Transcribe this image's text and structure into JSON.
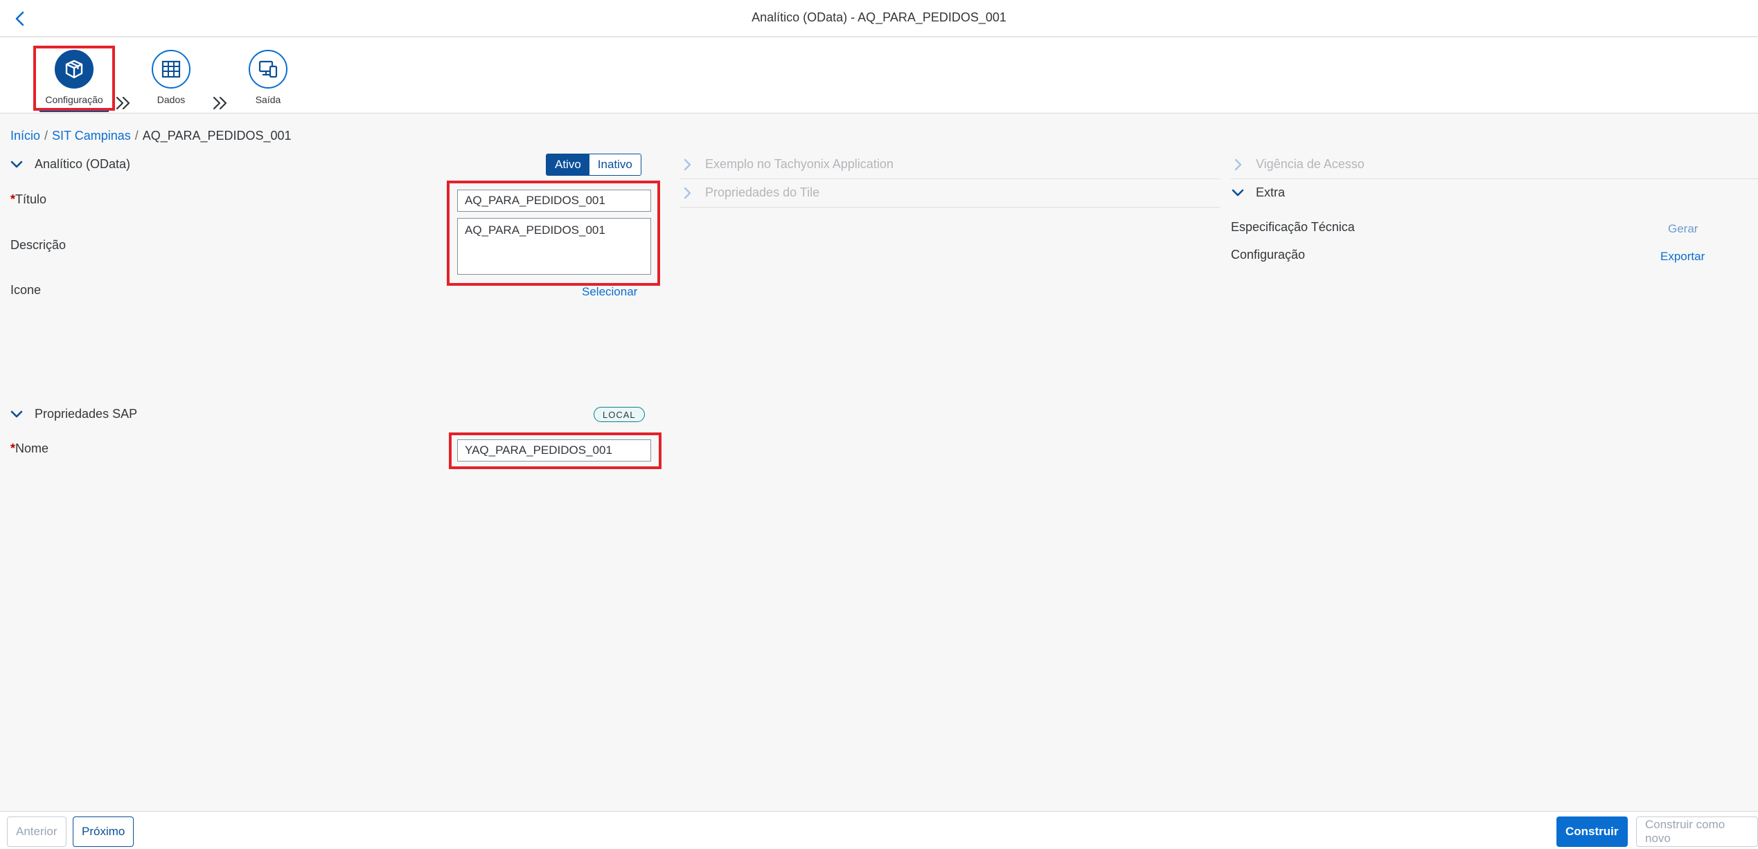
{
  "header": {
    "title": "Analítico (OData) - AQ_PARA_PEDIDOS_001"
  },
  "wizard": {
    "steps": [
      {
        "label": "Configuração",
        "icon": "package-icon",
        "active": true
      },
      {
        "label": "Dados",
        "icon": "grid-table-icon",
        "active": false
      },
      {
        "label": "Saída",
        "icon": "devices-icon",
        "active": false
      }
    ]
  },
  "breadcrumb": {
    "items": [
      "Início",
      "SIT Campinas",
      "AQ_PARA_PEDIDOS_001"
    ]
  },
  "general": {
    "panel_title": "Analítico (OData)",
    "status_options": [
      "Ativo",
      "Inativo"
    ],
    "status_selected": "Ativo",
    "title_label": "Título",
    "title_value": "AQ_PARA_PEDIDOS_001",
    "description_label": "Descrição",
    "description_value": "AQ_PARA_PEDIDOS_001",
    "icon_label": "Icone",
    "icon_select_label": "Selecionar"
  },
  "sap_properties": {
    "panel_title": "Propriedades SAP",
    "badge": "LOCAL",
    "name_label": "Nome",
    "name_value": "YAQ_PARA_PEDIDOS_001"
  },
  "middle_panels": {
    "example": "Exemplo no Tachyonix Application",
    "tile_properties": "Propriedades do Tile"
  },
  "right_panels": {
    "access_validity": "Vigência de Acesso",
    "extra": {
      "title": "Extra",
      "tech_spec_label": "Especificação Técnica",
      "tech_spec_action": "Gerar",
      "config_label": "Configuração",
      "config_action": "Exportar"
    }
  },
  "footer": {
    "previous": "Anterior",
    "next": "Próximo",
    "build": "Construir",
    "build_as_new": "Construir como novo"
  },
  "colors": {
    "accent": "#0a6ed1",
    "accent_dark": "#0a4f98",
    "highlight": "#e4222a",
    "required": "#bb0000",
    "background": "#f7f7f7"
  }
}
